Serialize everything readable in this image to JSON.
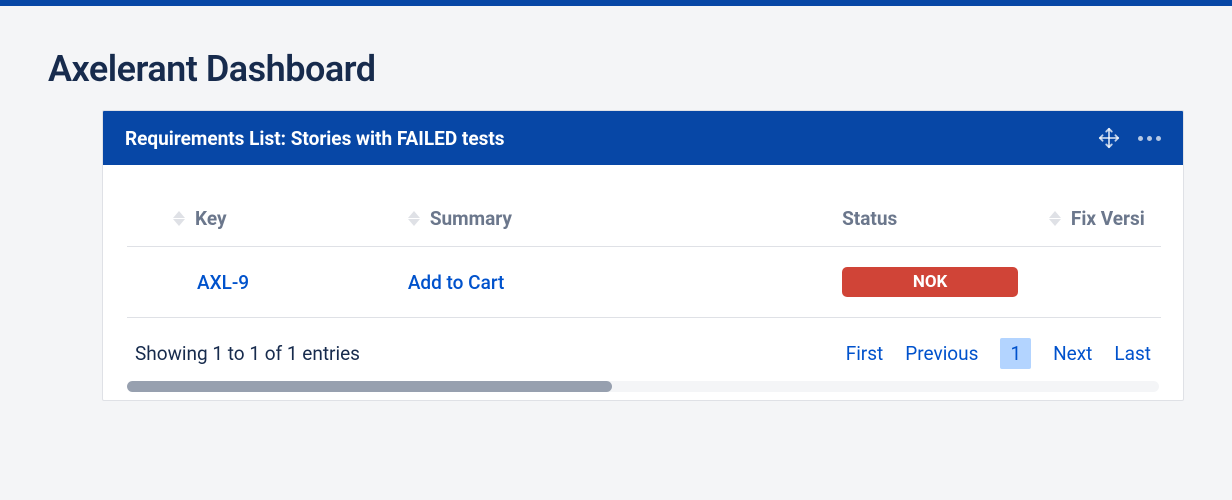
{
  "page": {
    "title": "Axelerant Dashboard"
  },
  "gadget": {
    "title": "Requirements List: Stories with FAILED tests"
  },
  "table": {
    "columns": {
      "key": "Key",
      "summary": "Summary",
      "status": "Status",
      "fix_version": "Fix Versi"
    },
    "rows": [
      {
        "key": "AXL-9",
        "summary": "Add to Cart",
        "status": "NOK",
        "fix_version": ""
      }
    ],
    "footer_info": "Showing 1 to 1 of 1 entries",
    "pagination": {
      "first": "First",
      "previous": "Previous",
      "current": "1",
      "next": "Next",
      "last": "Last"
    }
  }
}
